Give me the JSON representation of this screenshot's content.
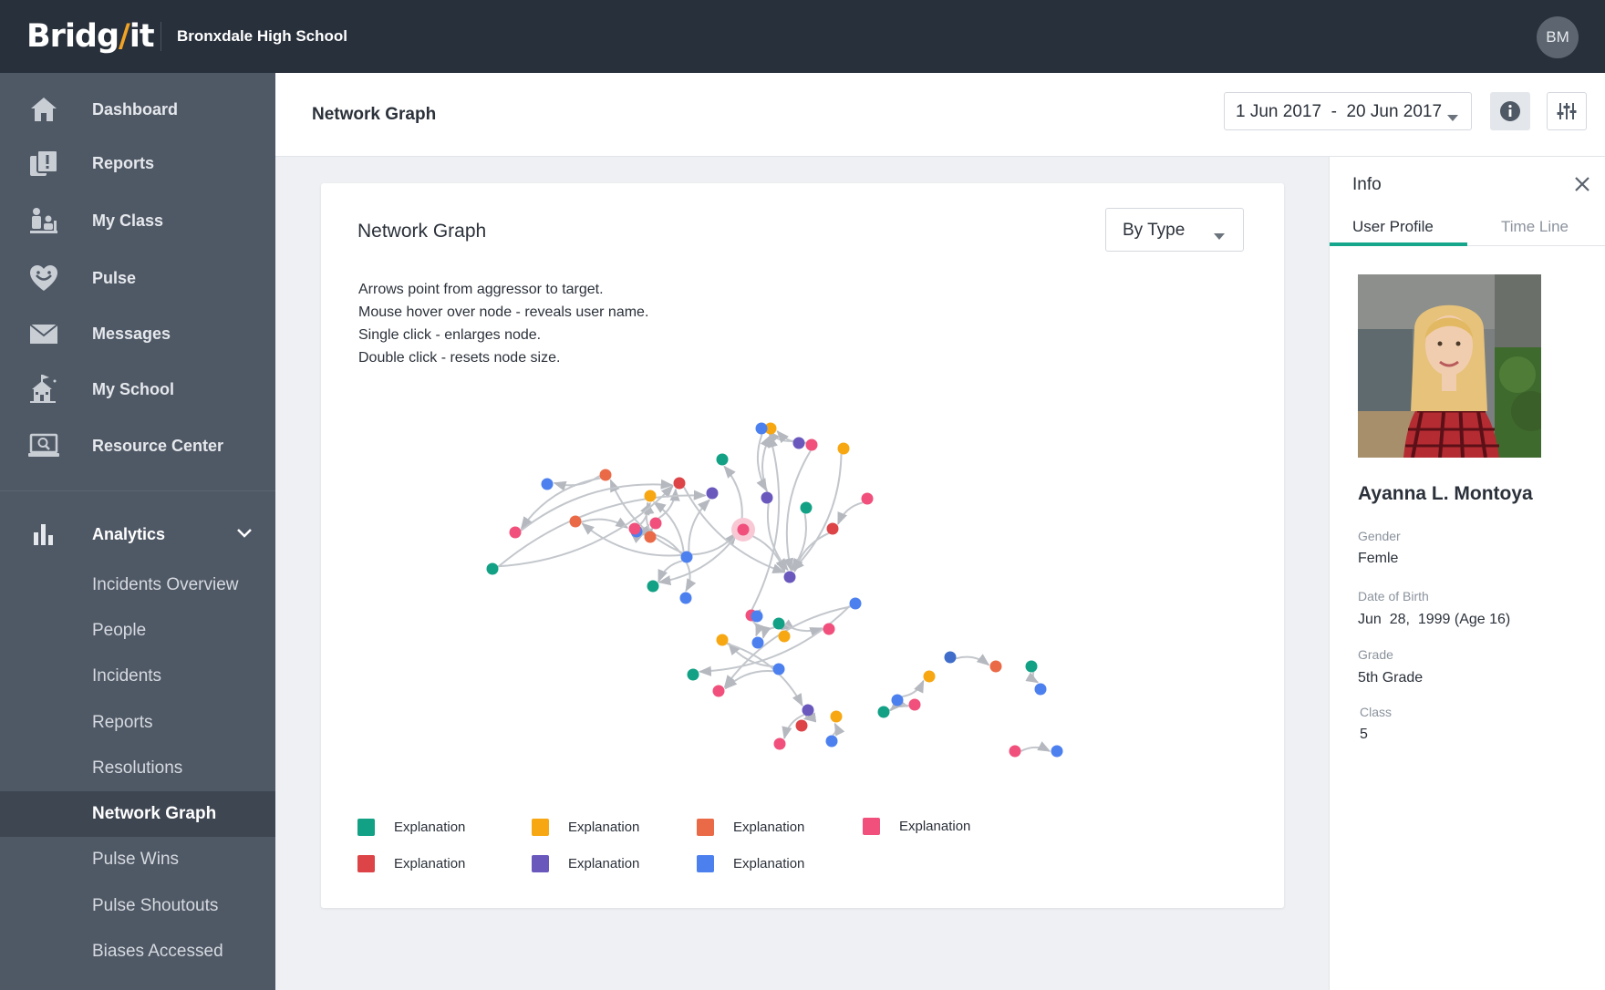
{
  "app": {
    "brand": "Bridgit",
    "school": "Bronxdale High School",
    "user_initials": "BM"
  },
  "sidebar": {
    "items": [
      {
        "label": "Dashboard",
        "icon": "home-icon"
      },
      {
        "label": "Reports",
        "icon": "report-alert-icon"
      },
      {
        "label": "My Class",
        "icon": "class-people-icon"
      },
      {
        "label": "Pulse",
        "icon": "heart-pulse-icon"
      },
      {
        "label": "Messages",
        "icon": "envelope-icon"
      },
      {
        "label": "My School",
        "icon": "school-building-icon"
      },
      {
        "label": "Resource Center",
        "icon": "laptop-search-icon"
      }
    ],
    "analytics": {
      "label": "Analytics",
      "sub_items": [
        "Incidents Overview",
        "People",
        "Incidents",
        "Reports",
        "Resolutions",
        "Network Graph",
        "Pulse Wins",
        "Pulse Shoutouts",
        "Biases Accessed"
      ],
      "active": "Network Graph"
    }
  },
  "header": {
    "title": "Network Graph",
    "date_range": "1 Jun 2017  -  20 Jun 2017"
  },
  "card": {
    "title": "Network Graph",
    "group_select": "By Type",
    "instructions": [
      "Arrows point from aggressor to target.",
      "Mouse hover over node - reveals user name.",
      "Single click - enlarges node.",
      "Double click - resets node size."
    ],
    "legend": [
      {
        "label": "Explanation",
        "color": "#12a185"
      },
      {
        "label": "Explanation",
        "color": "#f7a712"
      },
      {
        "label": "Explanation",
        "color": "#ea6a48"
      },
      {
        "label": "Explanation",
        "color": "#f0507b"
      },
      {
        "label": "Explanation",
        "color": "#dc4447"
      },
      {
        "label": "Explanation",
        "color": "#6a58bd"
      },
      {
        "label": "Explanation",
        "color": "#4d80ef"
      }
    ],
    "nodes": [
      {
        "id": 1,
        "color": "#4d80ef"
      },
      {
        "id": 2,
        "color": "#f0507b"
      },
      {
        "id": 3,
        "color": "#12a185"
      },
      {
        "id": 4,
        "color": "#4d80ef"
      },
      {
        "id": 5,
        "color": "#f0507b"
      },
      {
        "id": 6,
        "color": "#ea6a48"
      },
      {
        "id": 7,
        "color": "#dc4447"
      },
      {
        "id": 8,
        "color": "#6a58bd"
      },
      {
        "id": 9,
        "color": "#f7a712"
      },
      {
        "id": 10,
        "color": "#ea6a48"
      },
      {
        "id": 11,
        "color": "#4d80ef"
      },
      {
        "id": 12,
        "color": "#f0507b"
      },
      {
        "id": 13,
        "color": "#ea6a48"
      },
      {
        "id": 14,
        "color": "#12a185"
      },
      {
        "id": 15,
        "color": "#4d80ef"
      },
      {
        "id": 16,
        "color": "#f0507b"
      },
      {
        "id": 17,
        "color": "#12a185"
      },
      {
        "id": 18,
        "color": "#6a58bd"
      },
      {
        "id": 19,
        "color": "#f0507b"
      },
      {
        "id": 20,
        "color": "#f7a712"
      },
      {
        "id": 21,
        "color": "#6a58bd"
      },
      {
        "id": 22,
        "color": "#f7a712"
      },
      {
        "id": 23,
        "color": "#4d80ef"
      },
      {
        "id": 24,
        "color": "#6a58bd"
      },
      {
        "id": 25,
        "color": "#12a185"
      },
      {
        "id": 26,
        "color": "#dc4447"
      },
      {
        "id": 27,
        "color": "#f0507b"
      },
      {
        "id": 28,
        "color": "#f0507b"
      },
      {
        "id": 29,
        "color": "#4d80ef"
      },
      {
        "id": 30,
        "color": "#4d80ef"
      },
      {
        "id": 31,
        "color": "#12a185"
      },
      {
        "id": 32,
        "color": "#f7a712"
      },
      {
        "id": 33,
        "color": "#f0507b"
      },
      {
        "id": 34,
        "color": "#4d80ef"
      },
      {
        "id": 35,
        "color": "#12a185"
      },
      {
        "id": 36,
        "color": "#f0507b"
      },
      {
        "id": 37,
        "color": "#f7a712"
      },
      {
        "id": 38,
        "color": "#4d80ef"
      },
      {
        "id": 39,
        "color": "#6a58bd"
      },
      {
        "id": 40,
        "color": "#f0507b"
      },
      {
        "id": 41,
        "color": "#dc4447"
      },
      {
        "id": 42,
        "color": "#4d80ef"
      },
      {
        "id": 43,
        "color": "#f7a712"
      },
      {
        "id": 44,
        "color": "#12a185"
      },
      {
        "id": 45,
        "color": "#f0507b"
      },
      {
        "id": 46,
        "color": "#4d80ef"
      },
      {
        "id": 47,
        "color": "#f7a712"
      },
      {
        "id": 48,
        "color": "#3f6dc9"
      },
      {
        "id": 49,
        "color": "#ea6a48"
      },
      {
        "id": 50,
        "color": "#12a185"
      },
      {
        "id": 51,
        "color": "#4d80ef"
      },
      {
        "id": 52,
        "color": "#f0507b"
      },
      {
        "id": 53,
        "color": "#4d80ef"
      }
    ],
    "edges": [
      [
        10,
        1
      ],
      [
        10,
        2
      ],
      [
        11,
        10
      ],
      [
        11,
        12
      ],
      [
        11,
        13
      ],
      [
        11,
        14
      ],
      [
        11,
        15
      ],
      [
        11,
        16
      ],
      [
        11,
        8
      ],
      [
        11,
        9
      ],
      [
        13,
        12
      ],
      [
        12,
        5
      ],
      [
        12,
        4
      ],
      [
        12,
        6
      ],
      [
        6,
        9
      ],
      [
        4,
        9
      ],
      [
        2,
        7
      ],
      [
        3,
        7
      ],
      [
        16,
        14
      ],
      [
        16,
        17
      ],
      [
        16,
        18
      ],
      [
        5,
        7
      ],
      [
        3,
        8
      ],
      [
        19,
        18
      ],
      [
        20,
        18
      ],
      [
        21,
        18
      ],
      [
        21,
        22
      ],
      [
        23,
        21
      ],
      [
        24,
        23
      ],
      [
        26,
        18
      ],
      [
        25,
        18
      ],
      [
        27,
        26
      ],
      [
        28,
        29
      ],
      [
        28,
        22
      ],
      [
        28,
        30
      ],
      [
        31,
        30
      ],
      [
        31,
        32
      ],
      [
        31,
        33
      ],
      [
        34,
        35
      ],
      [
        34,
        36
      ],
      [
        38,
        37
      ],
      [
        38,
        36
      ],
      [
        37,
        39
      ],
      [
        39,
        40
      ],
      [
        39,
        41
      ],
      [
        42,
        43
      ],
      [
        44,
        45
      ],
      [
        46,
        47
      ],
      [
        48,
        49
      ],
      [
        50,
        51
      ],
      [
        52,
        53
      ],
      [
        7,
        18
      ],
      [
        19,
        22
      ],
      [
        45,
        44
      ]
    ]
  },
  "info_panel": {
    "title": "Info",
    "tabs": [
      "User Profile",
      "Time Line"
    ],
    "active_tab": "User Profile",
    "profile": {
      "name": "Ayanna L. Montoya",
      "fields": [
        {
          "label": "Gender",
          "value": "Femle"
        },
        {
          "label": "Date of Birth",
          "value": "Jun  28,  1999 (Age 16)"
        },
        {
          "label": "Grade",
          "value": "5th Grade"
        },
        {
          "label": "Class",
          "value": "5"
        }
      ]
    }
  }
}
